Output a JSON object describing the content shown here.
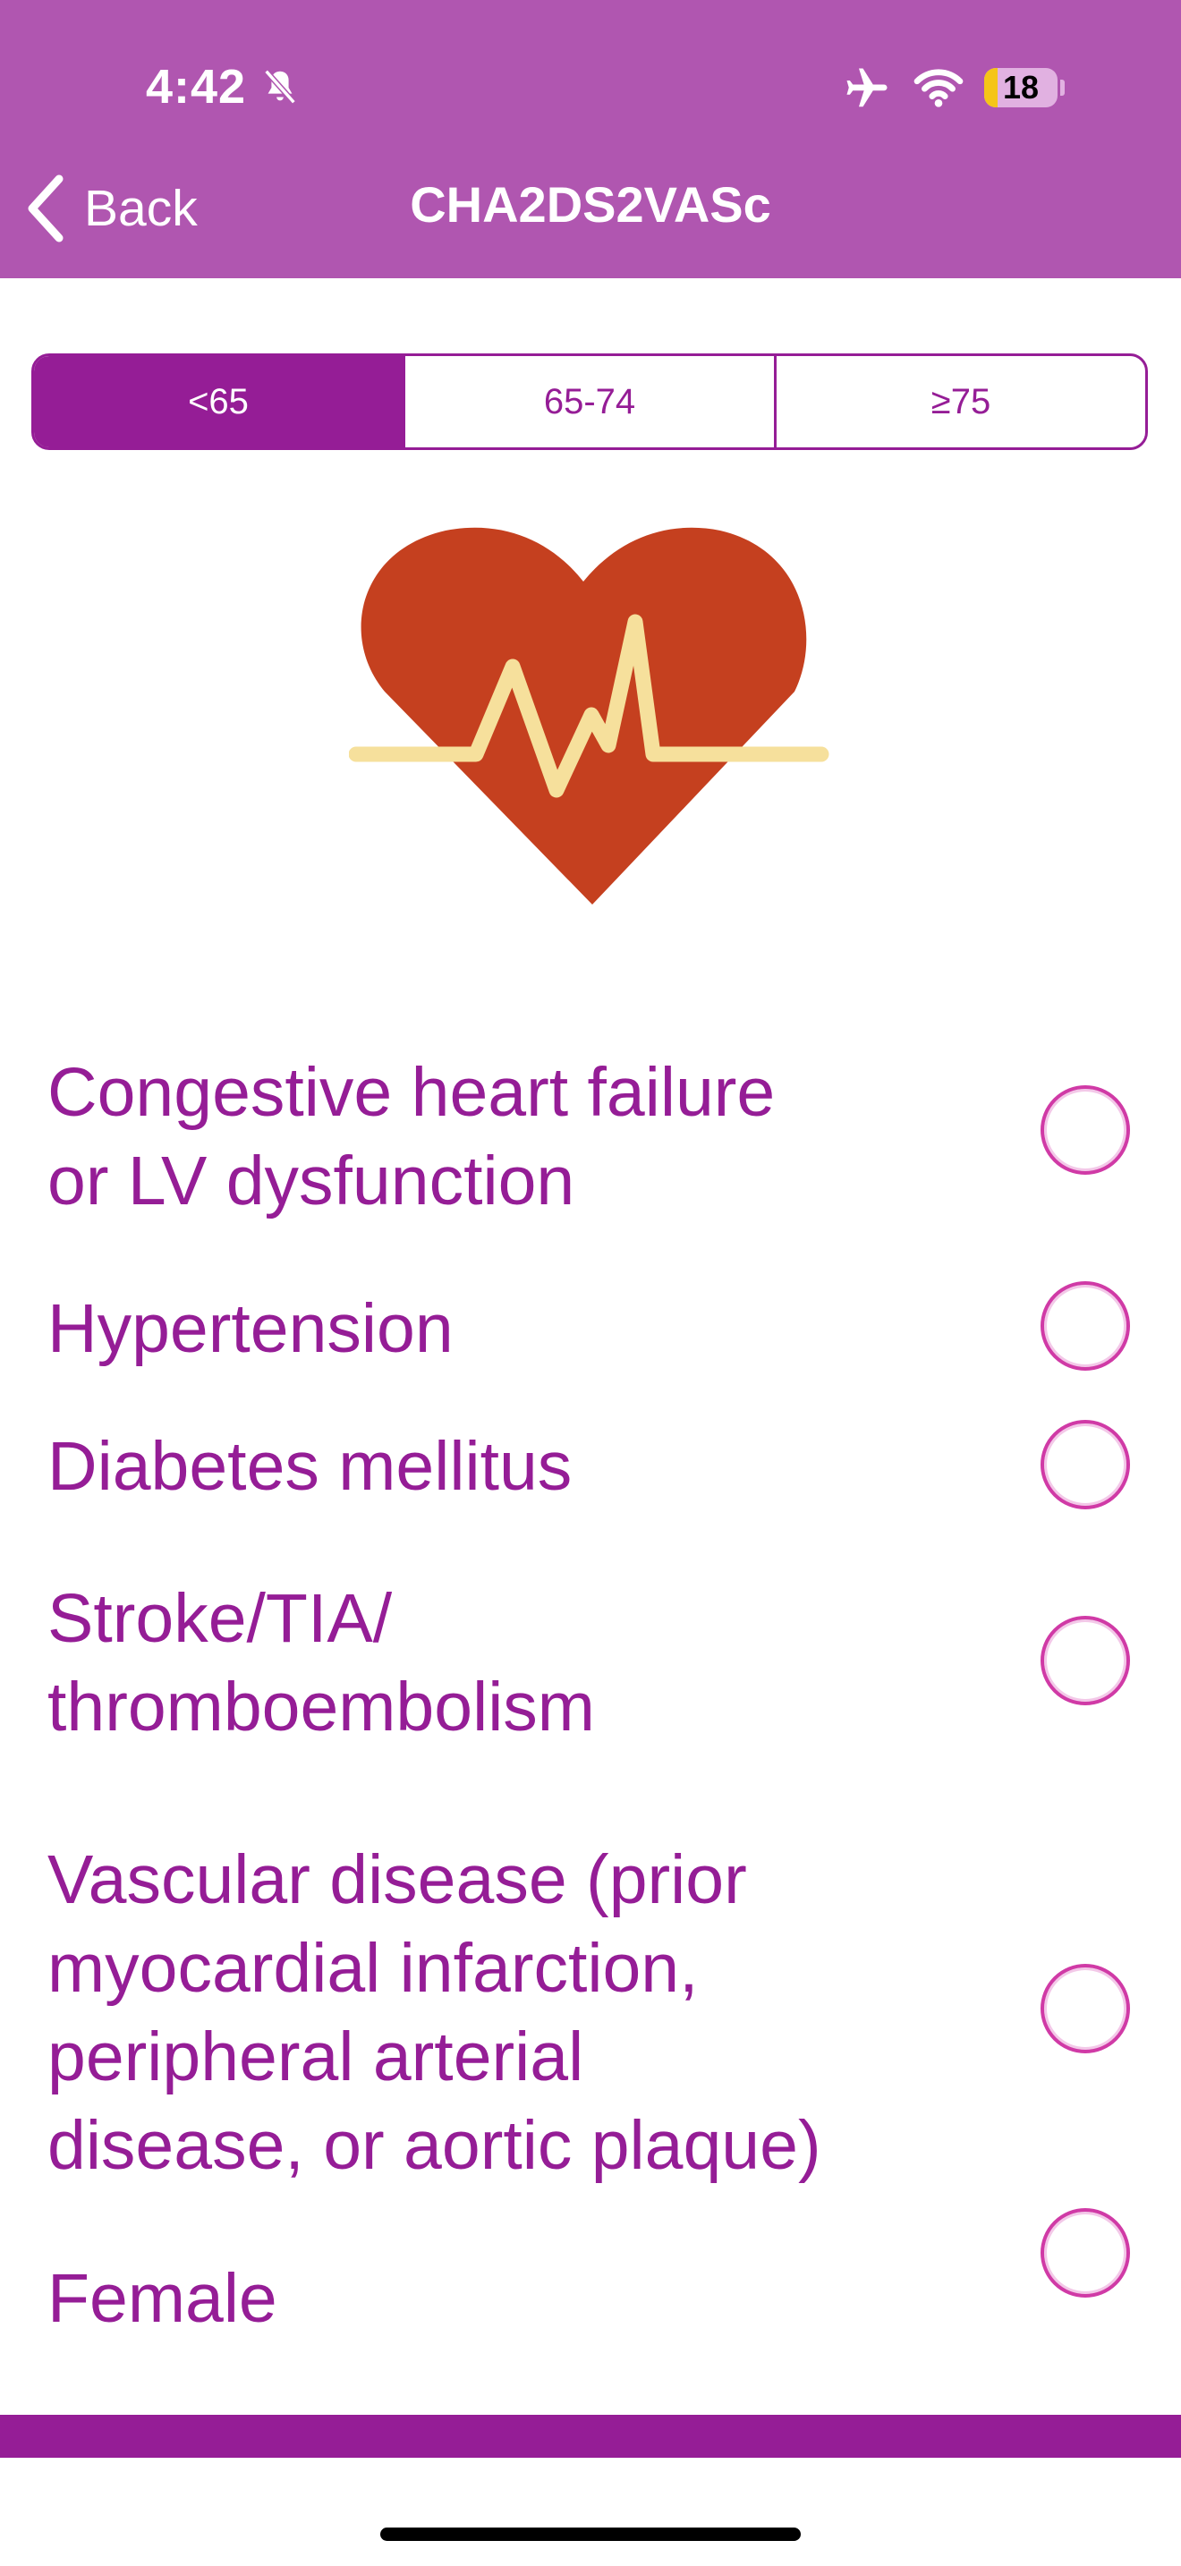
{
  "status_bar": {
    "time": "4:42",
    "battery_level": "18",
    "battery_fraction": 0.18
  },
  "nav": {
    "back_label": "Back",
    "title": "CHA2DS2VASc"
  },
  "age_segments": {
    "options": [
      "<65",
      "65-74",
      "≥75"
    ],
    "selected": "<65"
  },
  "criteria": [
    {
      "label_lines": [
        "Congestive heart failure",
        "or LV dysfunction"
      ],
      "checked": false
    },
    {
      "label_lines": [
        "Hypertension"
      ],
      "checked": false
    },
    {
      "label_lines": [
        "Diabetes mellitus"
      ],
      "checked": false
    },
    {
      "label_lines": [
        "Stroke/TIA/",
        "thromboembolism"
      ],
      "checked": false
    },
    {
      "label_lines": [
        "Vascular disease (prior",
        "myocardial infarction,",
        "peripheral arterial",
        "disease, or aortic plaque)"
      ],
      "checked": false
    },
    {
      "label_lines": [
        "Female"
      ],
      "checked": false
    }
  ],
  "icons": {
    "back": "chevron-left-icon",
    "bell": "bell-slash-icon",
    "airplane": "airplane-icon",
    "wifi": "wifi-icon",
    "heart": "heart-pulse-icon"
  },
  "colors": {
    "header": "#b056b0",
    "accent": "#951d96",
    "heart": "#c5401f",
    "pulse": "#f6e09c",
    "radio_border": "#d03aa6"
  }
}
